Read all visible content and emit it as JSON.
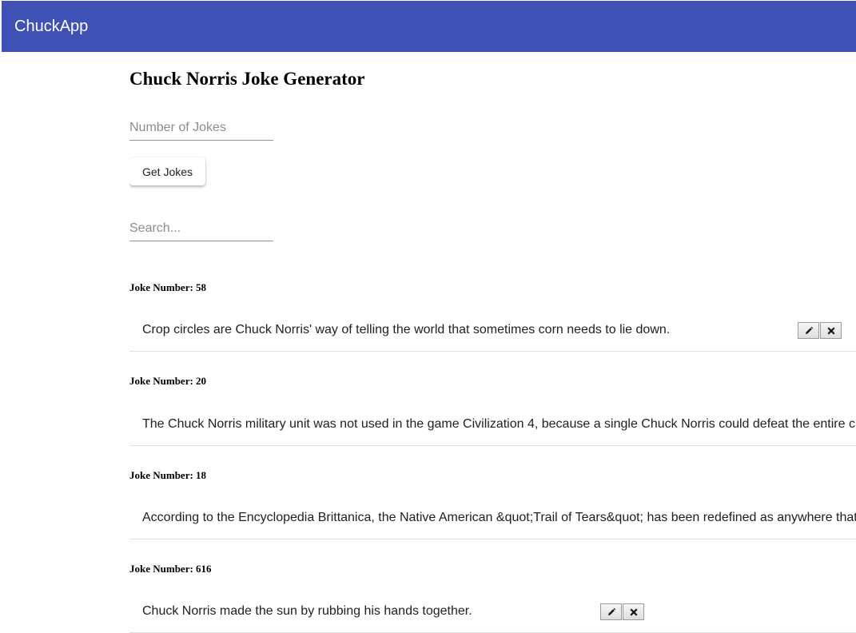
{
  "app": {
    "brand": "ChuckApp"
  },
  "page": {
    "title": "Chuck Norris Joke Generator"
  },
  "number_field": {
    "placeholder": "Number of Jokes",
    "value": ""
  },
  "get_button": {
    "label": "Get Jokes"
  },
  "search_field": {
    "placeholder": "Search...",
    "value": ""
  },
  "jokes": [
    {
      "heading": "Joke Number: 58",
      "text": "Crop circles are Chuck Norris' way of telling the world that sometimes corn needs to lie down.",
      "edit_icon": "pencil-icon",
      "delete_icon": "close-icon"
    },
    {
      "heading": "Joke Number: 20",
      "text": "The Chuck Norris military unit was not used in the game Civilization 4, because a single Chuck Norris could defeat the entire c",
      "edit_icon": "pencil-icon",
      "delete_icon": "close-icon"
    },
    {
      "heading": "Joke Number: 18",
      "text": "According to the Encyclopedia Brittanica, the Native American &quot;Trail of Tears&quot; has been redefined as anywhere that",
      "edit_icon": "pencil-icon",
      "delete_icon": "close-icon"
    },
    {
      "heading": "Joke Number: 616",
      "text": "Chuck Norris made the sun by rubbing his hands together.",
      "edit_icon": "pencil-icon",
      "delete_icon": "close-icon"
    }
  ],
  "colors": {
    "toolbar": "#3f51b5",
    "divider": "#e0e0e0"
  }
}
